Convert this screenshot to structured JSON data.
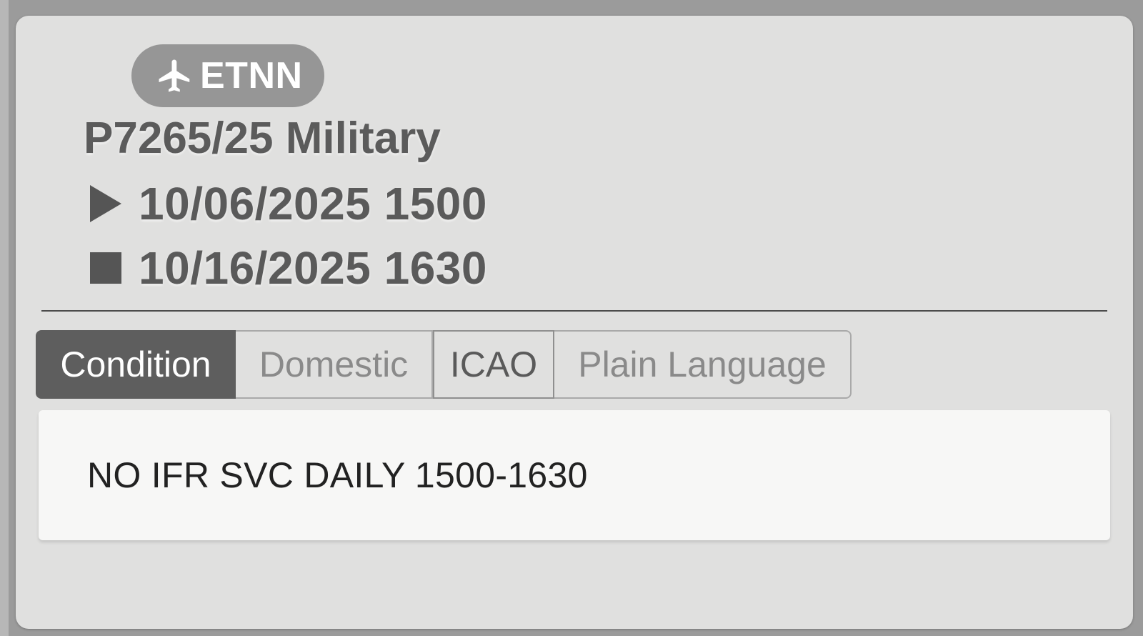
{
  "notam": {
    "airport_code": "ETNN",
    "airport_icon": "airplane-icon",
    "title": "P7265/25 Military",
    "start": {
      "icon": "play-icon",
      "value": "10/06/2025 1500"
    },
    "end": {
      "icon": "stop-icon",
      "value": "10/16/2025 1630"
    },
    "body_text": "NO IFR SVC DAILY 1500-1630"
  },
  "tabs": [
    {
      "label": "Condition",
      "active": true
    },
    {
      "label": "Domestic",
      "active": false
    },
    {
      "label": "ICAO",
      "active": false
    },
    {
      "label": "Plain Language",
      "active": false
    }
  ],
  "colors": {
    "page_background": "#9b9b9b",
    "card_background": "#e0e0df",
    "chip_background": "#969696",
    "active_tab": "#5e5e5e",
    "body_panel": "#f7f7f6"
  }
}
